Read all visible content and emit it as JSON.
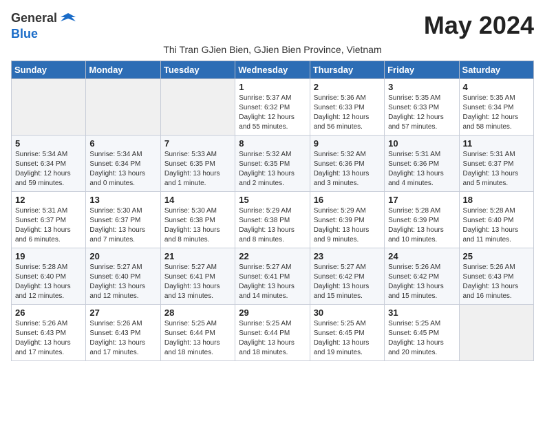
{
  "logo": {
    "general": "General",
    "blue": "Blue"
  },
  "title": "May 2024",
  "subtitle": "Thi Tran GJien Bien, GJien Bien Province, Vietnam",
  "days": [
    "Sunday",
    "Monday",
    "Tuesday",
    "Wednesday",
    "Thursday",
    "Friday",
    "Saturday"
  ],
  "weeks": [
    [
      {
        "day": "",
        "info": ""
      },
      {
        "day": "",
        "info": ""
      },
      {
        "day": "",
        "info": ""
      },
      {
        "day": "1",
        "info": "Sunrise: 5:37 AM\nSunset: 6:32 PM\nDaylight: 12 hours\nand 55 minutes."
      },
      {
        "day": "2",
        "info": "Sunrise: 5:36 AM\nSunset: 6:33 PM\nDaylight: 12 hours\nand 56 minutes."
      },
      {
        "day": "3",
        "info": "Sunrise: 5:35 AM\nSunset: 6:33 PM\nDaylight: 12 hours\nand 57 minutes."
      },
      {
        "day": "4",
        "info": "Sunrise: 5:35 AM\nSunset: 6:34 PM\nDaylight: 12 hours\nand 58 minutes."
      }
    ],
    [
      {
        "day": "5",
        "info": "Sunrise: 5:34 AM\nSunset: 6:34 PM\nDaylight: 12 hours\nand 59 minutes."
      },
      {
        "day": "6",
        "info": "Sunrise: 5:34 AM\nSunset: 6:34 PM\nDaylight: 13 hours\nand 0 minutes."
      },
      {
        "day": "7",
        "info": "Sunrise: 5:33 AM\nSunset: 6:35 PM\nDaylight: 13 hours\nand 1 minute."
      },
      {
        "day": "8",
        "info": "Sunrise: 5:32 AM\nSunset: 6:35 PM\nDaylight: 13 hours\nand 2 minutes."
      },
      {
        "day": "9",
        "info": "Sunrise: 5:32 AM\nSunset: 6:36 PM\nDaylight: 13 hours\nand 3 minutes."
      },
      {
        "day": "10",
        "info": "Sunrise: 5:31 AM\nSunset: 6:36 PM\nDaylight: 13 hours\nand 4 minutes."
      },
      {
        "day": "11",
        "info": "Sunrise: 5:31 AM\nSunset: 6:37 PM\nDaylight: 13 hours\nand 5 minutes."
      }
    ],
    [
      {
        "day": "12",
        "info": "Sunrise: 5:31 AM\nSunset: 6:37 PM\nDaylight: 13 hours\nand 6 minutes."
      },
      {
        "day": "13",
        "info": "Sunrise: 5:30 AM\nSunset: 6:37 PM\nDaylight: 13 hours\nand 7 minutes."
      },
      {
        "day": "14",
        "info": "Sunrise: 5:30 AM\nSunset: 6:38 PM\nDaylight: 13 hours\nand 8 minutes."
      },
      {
        "day": "15",
        "info": "Sunrise: 5:29 AM\nSunset: 6:38 PM\nDaylight: 13 hours\nand 8 minutes."
      },
      {
        "day": "16",
        "info": "Sunrise: 5:29 AM\nSunset: 6:39 PM\nDaylight: 13 hours\nand 9 minutes."
      },
      {
        "day": "17",
        "info": "Sunrise: 5:28 AM\nSunset: 6:39 PM\nDaylight: 13 hours\nand 10 minutes."
      },
      {
        "day": "18",
        "info": "Sunrise: 5:28 AM\nSunset: 6:40 PM\nDaylight: 13 hours\nand 11 minutes."
      }
    ],
    [
      {
        "day": "19",
        "info": "Sunrise: 5:28 AM\nSunset: 6:40 PM\nDaylight: 13 hours\nand 12 minutes."
      },
      {
        "day": "20",
        "info": "Sunrise: 5:27 AM\nSunset: 6:40 PM\nDaylight: 13 hours\nand 12 minutes."
      },
      {
        "day": "21",
        "info": "Sunrise: 5:27 AM\nSunset: 6:41 PM\nDaylight: 13 hours\nand 13 minutes."
      },
      {
        "day": "22",
        "info": "Sunrise: 5:27 AM\nSunset: 6:41 PM\nDaylight: 13 hours\nand 14 minutes."
      },
      {
        "day": "23",
        "info": "Sunrise: 5:27 AM\nSunset: 6:42 PM\nDaylight: 13 hours\nand 15 minutes."
      },
      {
        "day": "24",
        "info": "Sunrise: 5:26 AM\nSunset: 6:42 PM\nDaylight: 13 hours\nand 15 minutes."
      },
      {
        "day": "25",
        "info": "Sunrise: 5:26 AM\nSunset: 6:43 PM\nDaylight: 13 hours\nand 16 minutes."
      }
    ],
    [
      {
        "day": "26",
        "info": "Sunrise: 5:26 AM\nSunset: 6:43 PM\nDaylight: 13 hours\nand 17 minutes."
      },
      {
        "day": "27",
        "info": "Sunrise: 5:26 AM\nSunset: 6:43 PM\nDaylight: 13 hours\nand 17 minutes."
      },
      {
        "day": "28",
        "info": "Sunrise: 5:25 AM\nSunset: 6:44 PM\nDaylight: 13 hours\nand 18 minutes."
      },
      {
        "day": "29",
        "info": "Sunrise: 5:25 AM\nSunset: 6:44 PM\nDaylight: 13 hours\nand 18 minutes."
      },
      {
        "day": "30",
        "info": "Sunrise: 5:25 AM\nSunset: 6:45 PM\nDaylight: 13 hours\nand 19 minutes."
      },
      {
        "day": "31",
        "info": "Sunrise: 5:25 AM\nSunset: 6:45 PM\nDaylight: 13 hours\nand 20 minutes."
      },
      {
        "day": "",
        "info": ""
      }
    ]
  ]
}
